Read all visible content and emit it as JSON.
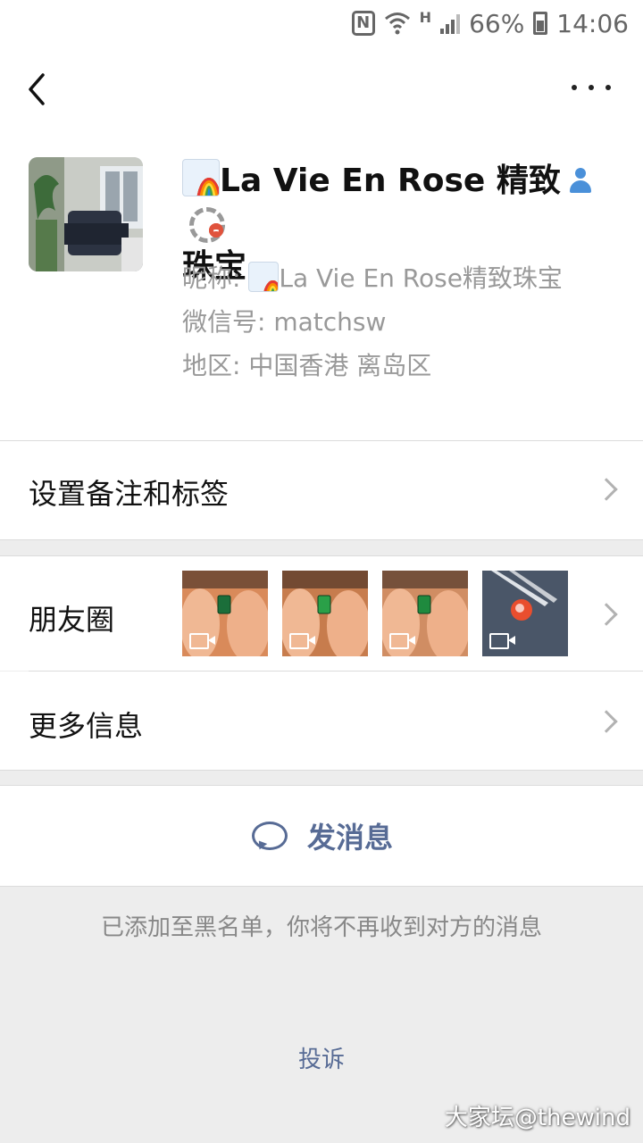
{
  "status_bar": {
    "nfc_label": "N",
    "network_type": "H",
    "battery": "66%",
    "time": "14:06"
  },
  "nav": {
    "back_icon": "chevron-left-icon",
    "more_icon": "more-dots-icon"
  },
  "profile": {
    "name_line1": "La Vie  En Rose 精致",
    "name_line2": "珠宝",
    "nickname_label": "昵称: ",
    "nickname_value": "La Vie  En Rose精致珠宝",
    "wechat_id": "微信号: matchsw",
    "region": "地区: 中国香港  离岛区"
  },
  "rows": {
    "remark_tags": "设置备注和标签",
    "moments": "朋友圈",
    "more_info": "更多信息"
  },
  "moments_thumbs": [
    {
      "gem_color": "#1b6e3a",
      "bg": "#d98a5a"
    },
    {
      "gem_color": "#2aa048",
      "bg": "#c77c4d"
    },
    {
      "gem_color": "#1f8a3e",
      "bg": "#d08d63"
    },
    {
      "gem_color": "#e94e2e",
      "bg": "#4a5668"
    }
  ],
  "actions": {
    "send_message": "发消息",
    "blacklist_notice": "已添加至黑名单，你将不再收到对方的消息",
    "complain": "投诉"
  },
  "watermark": "大家坛@thewind",
  "colors": {
    "link_blue": "#576b95",
    "background": "#ededed"
  }
}
